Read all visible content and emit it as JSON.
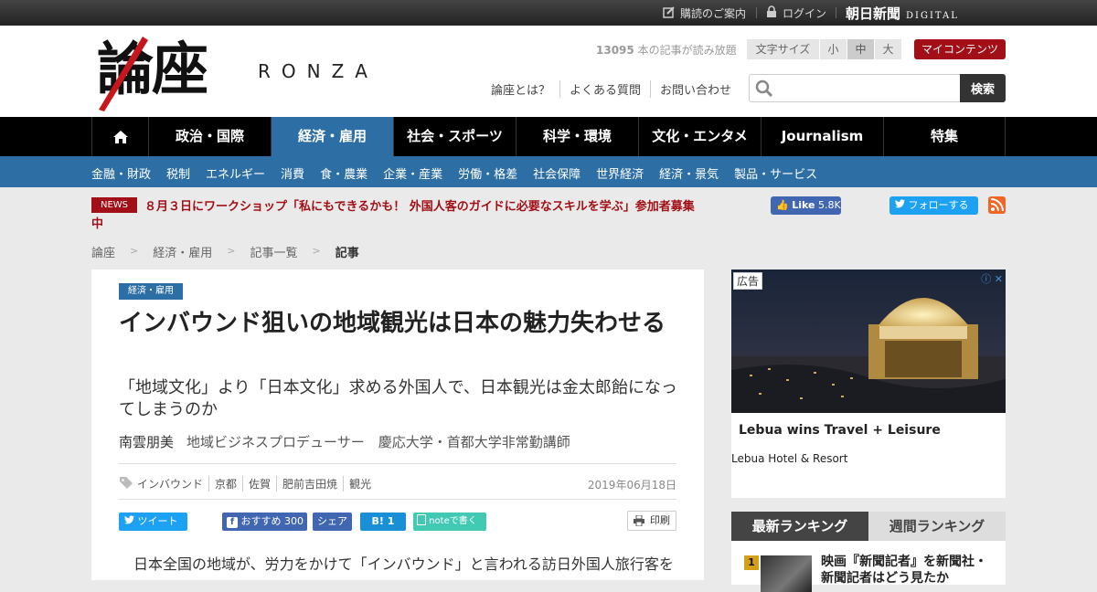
{
  "topbar": {
    "guide": "購読のご案内",
    "login": "ログイン",
    "brand": "朝日新聞",
    "brand_sub": "DIGITAL"
  },
  "header": {
    "logo_kanji": "論座",
    "logo_latin": "RONZA",
    "count_number": "13095",
    "count_text": " 本の記事が読み放題",
    "fontsize_label": "文字サイズ",
    "fontsize_options": [
      "小",
      "中",
      "大"
    ],
    "fontsize_selected": "中",
    "mycontents": "マイコンテンツ",
    "links": [
      "論座とは？",
      "よくある質問",
      "お問い合わせ"
    ],
    "search_placeholder": "",
    "search_button": "検索"
  },
  "gnav": {
    "items": [
      "政治・国際",
      "経済・雇用",
      "社会・スポーツ",
      "科学・環境",
      "文化・エンタメ",
      "Journalism",
      "特集"
    ],
    "active": "経済・雇用"
  },
  "subnav": [
    "金融・財政",
    "税制",
    "エネルギー",
    "消費",
    "食・農業",
    "企業・産業",
    "労働・格差",
    "社会保障",
    "世界経済",
    "経済・景気",
    "製品・サービス"
  ],
  "news": {
    "tag": "NEWS",
    "text": "８月３日にワークショップ「私にもできるかも！ 外国人客のガイドに必要なスキルを学ぶ」参加者募集中"
  },
  "social": {
    "like": "Like",
    "like_count": "5.8K",
    "follow": "フォローする"
  },
  "breadcrumb": [
    "論座",
    "経済・雇用",
    "記事一覧",
    "記事"
  ],
  "article": {
    "category": "経済・雇用",
    "title": "インバウンド狙いの地域観光は日本の魅力失わせる",
    "subtitle": "「地域文化」より「日本文化」求める外国人で、日本観光は金太郎飴になってしまうのか",
    "author": "南雲朋美",
    "author_role": "地域ビジネスプロデューサー　慶応大学・首都大学非常勤講師",
    "tags": [
      "インバウンド",
      "京都",
      "佐賀",
      "肥前吉田焼",
      "観光"
    ],
    "date": "2019年06月18日",
    "share": {
      "tweet": "ツイート",
      "list": "list",
      "recommend": "おすすめ",
      "recommend_count": "300",
      "share": "シェア",
      "hatena": "B!",
      "hatena_count": "1",
      "note": "noteで書く",
      "print": "印刷"
    },
    "body_first_line": "日本全国の地域が、労力をかけて「インバウンド」と言われる訪日外国人旅行客を"
  },
  "ad": {
    "label": "広告",
    "headline": "Lebua wins Travel + Leisure",
    "sponsor": "Lebua Hotel & Resort"
  },
  "ranking": {
    "tabs": [
      "最新ランキング",
      "週間ランキング"
    ],
    "active": "最新ランキング",
    "first_rank": "1",
    "first_title": "映画『新聞記者』を新聞社・新聞記者はどう見たか"
  },
  "colors": {
    "accent_blue": "#2d6fa5",
    "news_red": "#a30f16",
    "nav_black": "#000000"
  }
}
